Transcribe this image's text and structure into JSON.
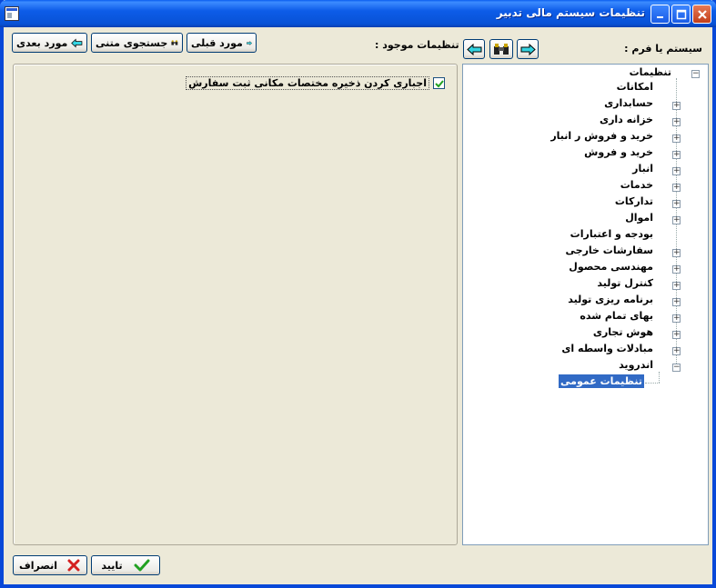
{
  "window": {
    "title": "تنظیمات سیستم مالی تدبیر"
  },
  "toolbar": {
    "next_label": "مورد بعدی",
    "text_search_label": "جستجوی متنی",
    "prev_label": "مورد قبلی",
    "existing_settings_label": "تنظیمات موجود :",
    "system_or_form_label": "سیستم یا فرم :"
  },
  "tree": {
    "root": "تنظیمات",
    "items": [
      {
        "label": "امکانات",
        "expandable": false
      },
      {
        "label": "حسابداری",
        "expandable": true
      },
      {
        "label": "خزانه داری",
        "expandable": true
      },
      {
        "label": "خرید و فروش ر انبار",
        "expandable": true
      },
      {
        "label": "خرید و فروش",
        "expandable": true
      },
      {
        "label": "انبار",
        "expandable": true
      },
      {
        "label": "خدمات",
        "expandable": true
      },
      {
        "label": "تدارکات",
        "expandable": true
      },
      {
        "label": "اموال",
        "expandable": true
      },
      {
        "label": "بودجه و اعتبارات",
        "expandable": false
      },
      {
        "label": "سفارشات خارجی",
        "expandable": true
      },
      {
        "label": "مهندسی محصول",
        "expandable": true
      },
      {
        "label": "کنترل تولید",
        "expandable": true
      },
      {
        "label": "برنامه ریزی تولید",
        "expandable": true
      },
      {
        "label": "بهای تمام شده",
        "expandable": true
      },
      {
        "label": "هوش تجاری",
        "expandable": true
      },
      {
        "label": "مبادلات واسطه ای",
        "expandable": true
      },
      {
        "label": "اندروید",
        "expandable": true,
        "expanded": true
      }
    ],
    "selected_child": "تنظیمات عمومی"
  },
  "settings": {
    "option1_label": "اجباری کردن ذخیره مختصات مکانی ثبت سفارش",
    "option1_checked": true
  },
  "footer": {
    "ok_label": "تایید",
    "cancel_label": "انصراف"
  },
  "colors": {
    "titlebar": "#0852d6",
    "selection": "#316ac5",
    "check": "#21a121",
    "cancel_x": "#d42020"
  }
}
